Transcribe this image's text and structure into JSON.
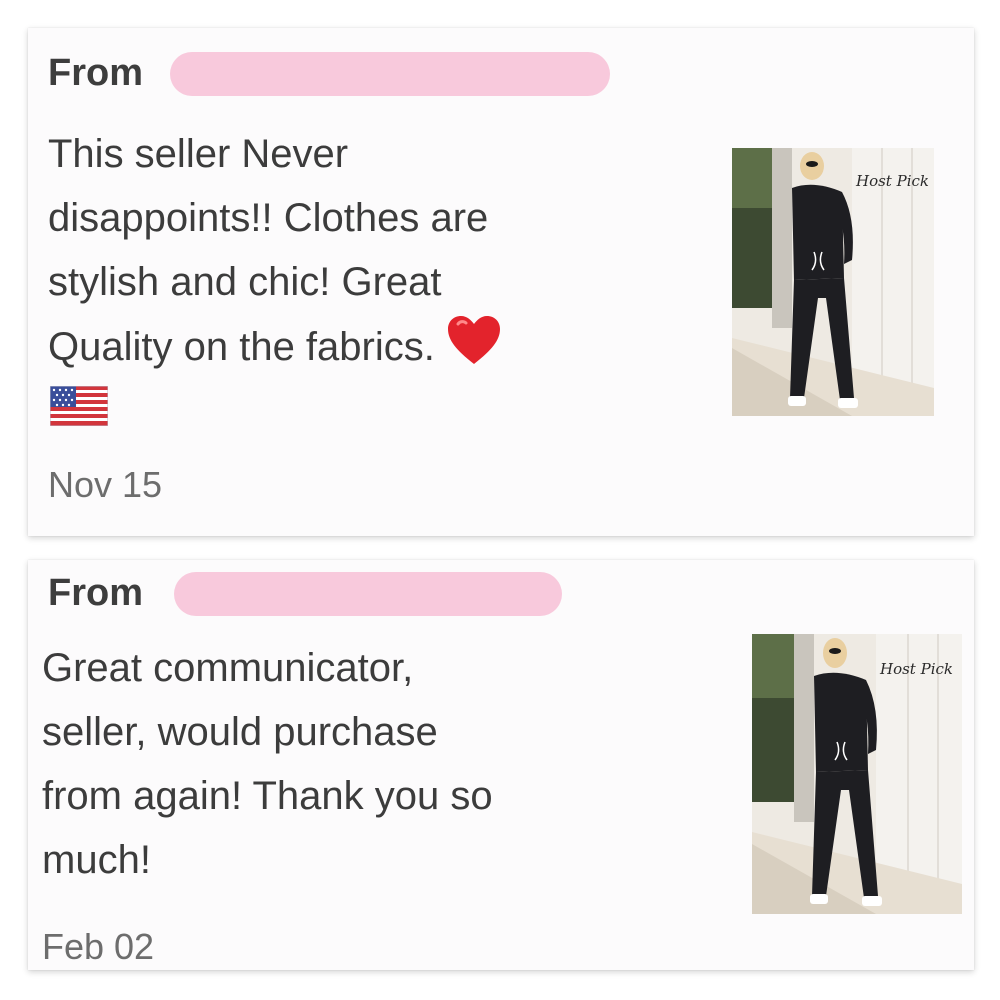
{
  "reviews": [
    {
      "from_label": "From",
      "lines": [
        "This seller Never",
        "disappoints!! Clothes are",
        "stylish and chic! Great",
        "Quality on the fabrics."
      ],
      "emoji": [
        "heart-emoji",
        "us-flag-emoji"
      ],
      "date": "Nov 15",
      "badge": "Host Pick"
    },
    {
      "from_label": "From",
      "lines": [
        "Great communicator,",
        "seller, would purchase",
        "from again! Thank you so",
        "much!"
      ],
      "date": "Feb 02",
      "badge": "Host Pick"
    }
  ],
  "colors": {
    "redaction": "#f8c9dc",
    "heart": "#e3232c",
    "text": "#3c3c3c"
  }
}
